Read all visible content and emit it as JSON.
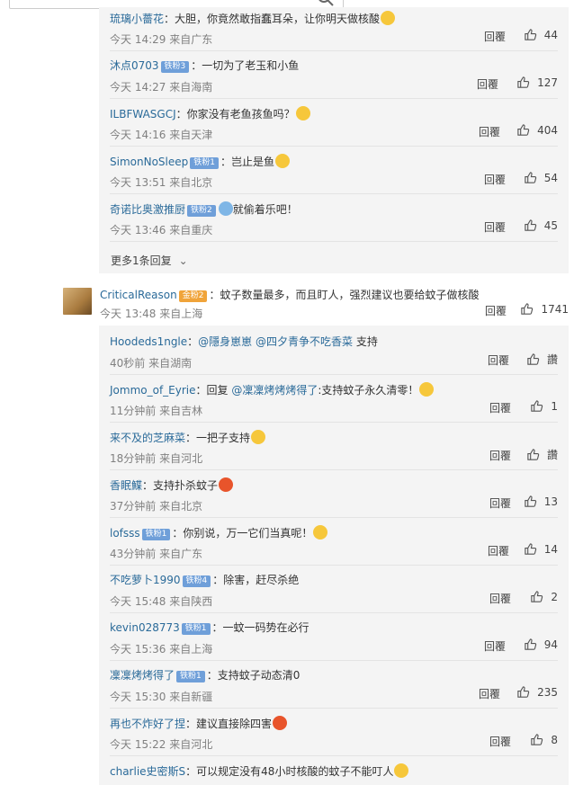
{
  "thread1": {
    "replies": [
      {
        "user": "琉璃小薔花",
        "badge": "",
        "text": "：大胆，你竟然敢指蠢耳朵，让你明天做核酸",
        "emoji": "yellow",
        "time": "今天 14:29 来自广东",
        "reply": "回覆",
        "likes": "44"
      },
      {
        "user": "沐点0703",
        "badge": "铁粉3",
        "text": "：一切为了老玉和小鱼",
        "emoji": "",
        "time": "今天 14:27 来自海南",
        "reply": "回覆",
        "likes": "127"
      },
      {
        "user": "ILBFWASGCJ",
        "badge": "",
        "text": "：你家没有老鱼孩鱼吗？",
        "emoji": "yellow",
        "time": "今天 14:16 来自天津",
        "reply": "回覆",
        "likes": "404"
      },
      {
        "user": "SimonNoSleep",
        "badge": "铁粉1",
        "text": "：岂止是鱼",
        "emoji": "yellow",
        "time": "今天 13:51 来自北京",
        "reply": "回覆",
        "likes": "54"
      },
      {
        "user": "奇诺比奥激推厨",
        "badge": "铁粉2",
        "text": "就偷着乐吧！",
        "emoji": "blue",
        "time": "今天 13:46 来自重庆",
        "reply": "回覆",
        "likes": "45"
      }
    ],
    "more": "更多1条回复"
  },
  "comment": {
    "user": "CriticalReason",
    "badge": "金粉2",
    "text": "：蚊子数量最多，而且盯人，强烈建议也要给蚊子做核酸",
    "time": "今天 13:48 来自上海",
    "reply": "回覆",
    "likes": "1741"
  },
  "thread2": {
    "replies": [
      {
        "user": "Hoodeds1ngle",
        "badge": "",
        "text": "：",
        "mention": "@隱身崽崽 @四夕青争不吃香菜",
        "tail": " 支持",
        "emoji": "",
        "time": "40秒前 来自湖南",
        "reply": "回覆",
        "likes": "讚"
      },
      {
        "user": "Jommo_of_Eyrie",
        "badge": "",
        "text": "：回复 ",
        "mention": "@凜凜烤烤烤得了",
        "tail": ":支持蚊子永久清零！",
        "emoji": "yellow",
        "time": "11分钟前 来自吉林",
        "reply": "回覆",
        "likes": "1"
      },
      {
        "user": "来不及的芝麻菜",
        "badge": "",
        "text": "：一把子支持",
        "emoji": "yellow",
        "time": "18分钟前 来自河北",
        "reply": "回覆",
        "likes": "讚"
      },
      {
        "user": "香眠鰈",
        "badge": "",
        "text": "：支持扑杀蚊子",
        "emoji": "red",
        "time": "37分钟前 来自北京",
        "reply": "回覆",
        "likes": "13"
      },
      {
        "user": "lofsss",
        "badge": "铁粉1",
        "text": "：你别说，万一它们当真呢！",
        "emoji": "yellow",
        "time": "43分钟前 来自广东",
        "reply": "回覆",
        "likes": "14"
      },
      {
        "user": "不吃萝卜1990",
        "badge": "铁粉4",
        "text": "：除害，赶尽杀绝",
        "emoji": "",
        "time": "今天 15:48 来自陕西",
        "reply": "回覆",
        "likes": "2"
      },
      {
        "user": "kevin028773",
        "badge": "铁粉1",
        "text": "：一蚊一码势在必行",
        "emoji": "",
        "time": "今天 15:36 来自上海",
        "reply": "回覆",
        "likes": "94"
      },
      {
        "user": "凜凜烤烤得了",
        "badge": "铁粉1",
        "text": "：支持蚊子动态清0",
        "emoji": "",
        "time": "今天 15:30 来自新疆",
        "reply": "回覆",
        "likes": "235"
      },
      {
        "user": "再也不炸好了捏",
        "badge": "",
        "text": "：建议直接除四害",
        "emoji": "red",
        "time": "今天 15:22 来自河北",
        "reply": "回覆",
        "likes": "8"
      },
      {
        "user": "charlie史密斯S",
        "badge": "",
        "text": "：可以规定没有48小时核酸的蚊子不能叮人",
        "emoji": "yellow",
        "time": "",
        "reply": "",
        "likes": ""
      }
    ]
  },
  "colors": {
    "username": "#2a6a99",
    "badge": "#6f9fd9",
    "gold_badge": "#f0a43a",
    "panel": "#f4f4f4"
  }
}
